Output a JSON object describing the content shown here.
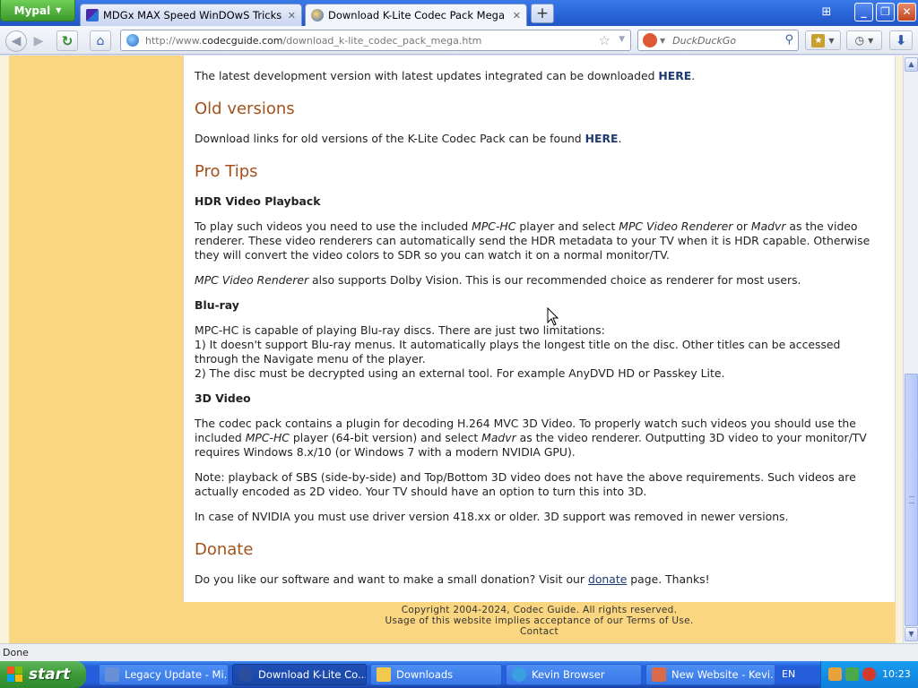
{
  "browser": {
    "app_menu_label": "Mypal",
    "tabs": [
      {
        "label": "MDGx MAX Speed WinDOwS Tricks + Secrets",
        "active": false
      },
      {
        "label": "Download K-Lite Codec Pack Mega",
        "active": true
      }
    ],
    "url_prefix": "http://www.",
    "url_host": "codecguide.com",
    "url_path": "/download_k-lite_codec_pack_mega.htm",
    "search_placeholder": "DuckDuckGo",
    "status_text": "Done"
  },
  "page": {
    "dev_version_text": "The latest development version with latest updates integrated can be downloaded ",
    "here_label": "HERE",
    "old_versions_heading": "Old versions",
    "old_versions_text": "Download links for old versions of the K-Lite Codec Pack can be found ",
    "pro_tips_heading": "Pro Tips",
    "hdr_heading": "HDR Video Playback",
    "hdr_p1_a": "To play such videos you need to use the included ",
    "hdr_p1_mpc": "MPC-HC",
    "hdr_p1_b": " player and select ",
    "hdr_p1_mvr": "MPC Video Renderer",
    "hdr_p1_c": " or ",
    "hdr_p1_madvr": "Madvr",
    "hdr_p1_d": " as the video renderer. These video renderers can automatically send the HDR metadata to your TV when it is HDR capable. Otherwise they will convert the video colors to SDR so you can watch it on a normal monitor/TV.",
    "hdr_p2_mvr": "MPC Video Renderer",
    "hdr_p2_rest": " also supports Dolby Vision. This is our recommended choice as renderer for most users.",
    "bluray_heading": "Blu-ray",
    "bluray_line1": "MPC-HC is capable of playing Blu-ray discs. There are just two limitations:",
    "bluray_line2": "1) It doesn't support Blu-ray menus. It automatically plays the longest title on the disc. Other titles can be accessed through the Navigate menu of the player.",
    "bluray_line3": "2) The disc must be decrypted using an external tool. For example AnyDVD HD or Passkey Lite.",
    "video3d_heading": "3D Video",
    "v3d_p1_a": "The codec pack contains a plugin for decoding H.264 MVC 3D Video. To properly watch such videos you should use the included ",
    "v3d_p1_mpc": "MPC-HC",
    "v3d_p1_b": " player (64-bit version) and select ",
    "v3d_p1_madvr": "Madvr",
    "v3d_p1_c": " as the video renderer. Outputting 3D video to your monitor/TV requires Windows 8.x/10 (or Windows 7 with a modern NVIDIA GPU).",
    "v3d_p2": "Note: playback of SBS (side-by-side) and Top/Bottom 3D video does not have the above requirements. Such videos are actually encoded as 2D video. Your TV should have an option to turn this into 3D.",
    "v3d_p3": "In case of NVIDIA you must use driver version 418.xx or older. 3D support was removed in newer versions.",
    "donate_heading": "Donate",
    "donate_a": "Do you like our software and want to make a small donation? Visit our ",
    "donate_link": "donate",
    "donate_b": " page. Thanks!"
  },
  "footer": {
    "copyright": "Copyright 2004-2024, Codec Guide. All rights reserved.",
    "usage_a": "Usage of this website implies acceptance of our ",
    "terms_link": "Terms of Use",
    "usage_b": ".",
    "contact_link": "Contact"
  },
  "taskbar": {
    "start_label": "start",
    "tasks": [
      {
        "label": "Legacy Update - Mi...",
        "icon_color": "#6b8fd6"
      },
      {
        "label": "Download K-Lite Co...",
        "icon_color": "#2b4f9e"
      },
      {
        "label": "Downloads",
        "icon_color": "#f2c94c"
      },
      {
        "label": "Kevin Browser",
        "icon_color": "#3aa0e0"
      },
      {
        "label": "New Website - Kevi...",
        "icon_color": "#d96b4a"
      }
    ],
    "language": "EN",
    "clock": "10:23"
  },
  "colors": {
    "heading": "#a3511c",
    "link": "#1d3a6e",
    "sidebar": "#fbd680",
    "page_bg": "#f9f2dd"
  }
}
